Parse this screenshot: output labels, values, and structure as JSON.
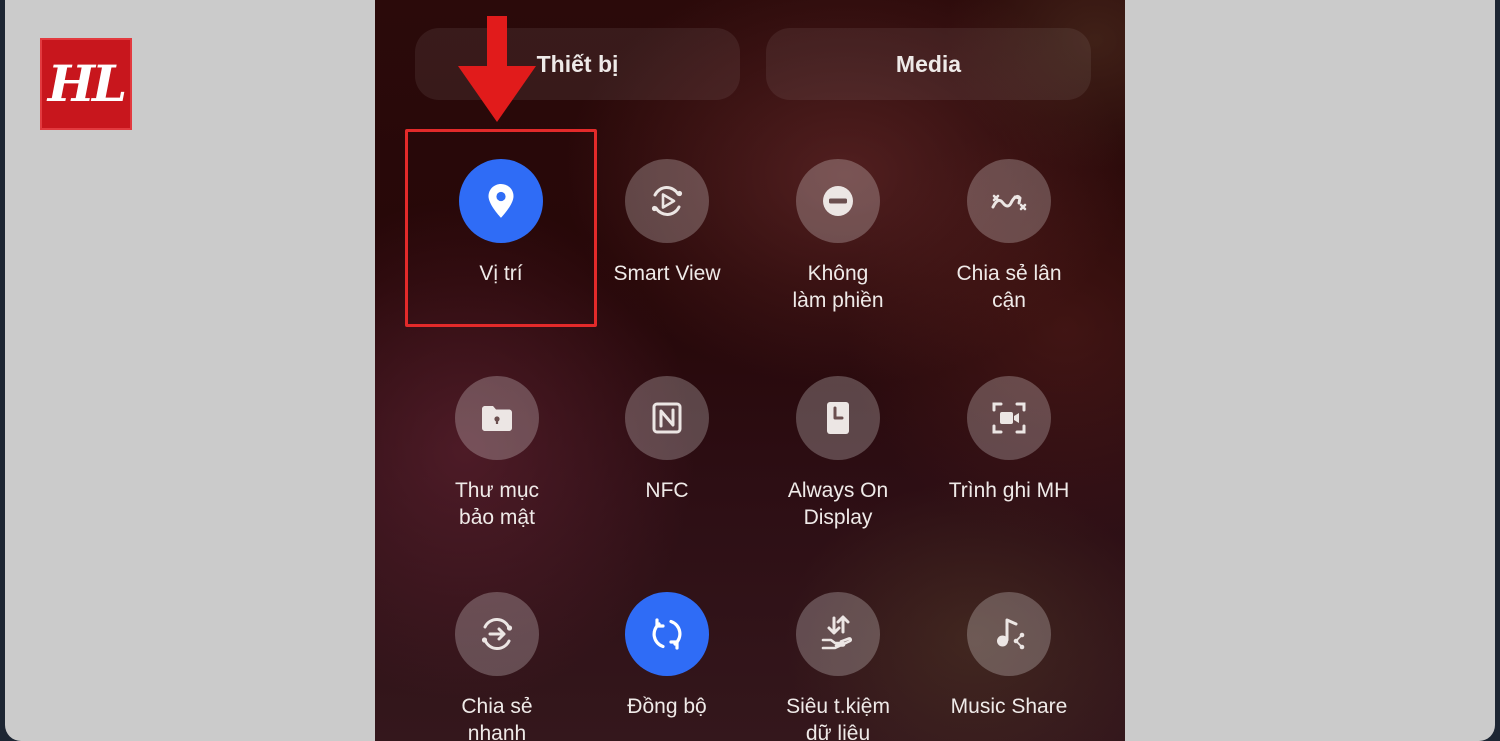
{
  "brand": {
    "logo_text": "HL",
    "logo_color": "#c8161d"
  },
  "tabs": [
    {
      "label": "Thiết bị"
    },
    {
      "label": "Media"
    }
  ],
  "annotation": {
    "highlight_color": "#e32a2a",
    "target": "Vị trí"
  },
  "colors": {
    "active_tile": "#2f6cf6",
    "inactive_tile": "rgba(255,255,255,0.24)"
  },
  "tiles": [
    {
      "label": "Vị trí",
      "icon": "location-pin-icon",
      "active": true
    },
    {
      "label": "Smart View",
      "icon": "smart-view-icon",
      "active": false
    },
    {
      "label": "Không\nlàm phiền",
      "icon": "do-not-disturb-icon",
      "active": false
    },
    {
      "label": "Chia sẻ lân\ncận",
      "icon": "nearby-share-icon",
      "active": false
    },
    {
      "label": "Thư mục\nbảo mật",
      "icon": "secure-folder-icon",
      "active": false
    },
    {
      "label": "NFC",
      "icon": "nfc-icon",
      "active": false
    },
    {
      "label": "Always On\nDisplay",
      "icon": "always-on-display-icon",
      "active": false
    },
    {
      "label": "Trình ghi MH",
      "icon": "screen-recorder-icon",
      "active": false
    },
    {
      "label": "Chia sẻ\nnhanh",
      "icon": "quick-share-icon",
      "active": false
    },
    {
      "label": "Đồng bộ",
      "icon": "sync-icon",
      "active": true
    },
    {
      "label": "Siêu t.kiệm\ndữ liệu",
      "icon": "data-saver-icon",
      "active": false
    },
    {
      "label": "Music Share",
      "icon": "music-share-icon",
      "active": false
    }
  ]
}
